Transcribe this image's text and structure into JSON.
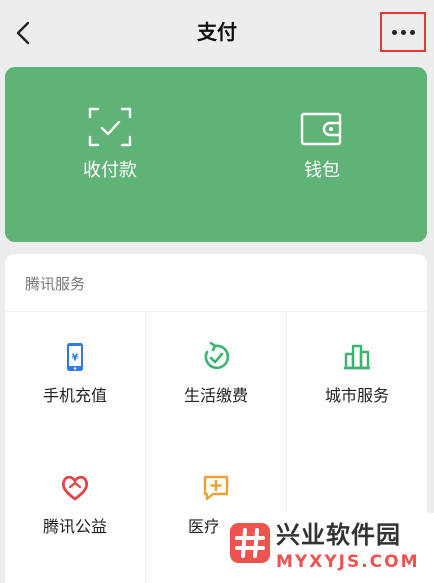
{
  "nav": {
    "title": "支付",
    "back_icon": "chevron-left-icon",
    "more_icon": "more-horizontal-icon"
  },
  "wallet": {
    "items": [
      {
        "label": "收付款",
        "icon": "scan-check-icon"
      },
      {
        "label": "钱包",
        "icon": "wallet-icon"
      }
    ],
    "color": "#5fb377"
  },
  "services": {
    "title": "腾讯服务",
    "items": [
      {
        "label": "手机充值",
        "icon": "phone-yuan-icon",
        "color": "#2f7be6"
      },
      {
        "label": "生活缴费",
        "icon": "check-drop-icon",
        "color": "#3cb371"
      },
      {
        "label": "城市服务",
        "icon": "city-buildings-icon",
        "color": "#3cb371"
      },
      {
        "label": "腾讯公益",
        "icon": "heart-charity-icon",
        "color": "#e04848"
      },
      {
        "label": "医疗",
        "icon": "medical-plus-icon",
        "color": "#f0a030"
      }
    ]
  },
  "watermark": {
    "line1": "兴业软件园",
    "line2": "MYXYJS.COM"
  },
  "highlight_color": "#e53935"
}
